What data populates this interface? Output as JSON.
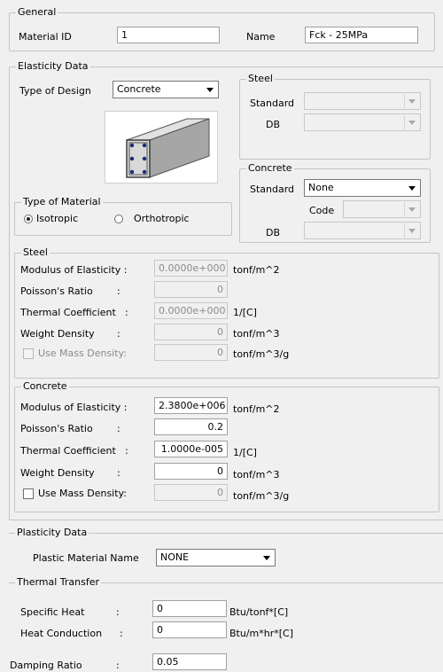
{
  "general": {
    "title": "General",
    "material_id_label": "Material ID",
    "material_id": "1",
    "name_label": "Name",
    "name": "Fck - 25MPa"
  },
  "elasticity": {
    "title": "Elasticity Data",
    "type_of_design_label": "Type of Design",
    "type_of_design": "Concrete",
    "type_of_material": {
      "title": "Type of Material",
      "isotropic": "Isotropic",
      "orthotropic": "Orthotropic",
      "selected": "Isotropic"
    },
    "steel_db": {
      "title": "Steel",
      "standard_label": "Standard",
      "standard": "",
      "db_label": "DB",
      "db": ""
    },
    "concrete_db": {
      "title": "Concrete",
      "standard_label": "Standard",
      "standard": "None",
      "code_label": "Code",
      "code": "",
      "db_label": "DB",
      "db": ""
    },
    "steel": {
      "title": "Steel",
      "modulus_label": "Modulus of Elasticity :",
      "modulus": "0.0000e+000",
      "modulus_unit": "tonf/m^2",
      "poisson_label": "Poisson's Ratio",
      "poisson": "0",
      "thermal_label": "Thermal Coefficient",
      "thermal": "0.0000e+000",
      "thermal_unit": "1/[C]",
      "weight_label": "Weight Density",
      "weight": "0",
      "weight_unit": "tonf/m^3",
      "mass_label": "Use Mass Density:",
      "mass": "0",
      "mass_unit": "tonf/m^3/g"
    },
    "concrete": {
      "title": "Concrete",
      "modulus_label": "Modulus of Elasticity :",
      "modulus": "2.3800e+006",
      "modulus_unit": "tonf/m^2",
      "poisson_label": "Poisson's Ratio",
      "poisson": "0.2",
      "thermal_label": "Thermal Coefficient",
      "thermal": "1.0000e-005",
      "thermal_unit": "1/[C]",
      "weight_label": "Weight Density",
      "weight": "0",
      "weight_unit": "tonf/m^3",
      "mass_label": "Use Mass Density:",
      "mass": "0",
      "mass_unit": "tonf/m^3/g"
    }
  },
  "plasticity": {
    "title": "Plasticity Data",
    "plastic_label": "Plastic Material Name",
    "plastic": "NONE"
  },
  "thermal_transfer": {
    "title": "Thermal Transfer",
    "specific_heat_label": "Specific Heat",
    "specific_heat": "0",
    "specific_heat_unit": "Btu/tonf*[C]",
    "conduction_label": "Heat Conduction",
    "conduction": "0",
    "conduction_unit": "Btu/m*hr*[C]"
  },
  "damping": {
    "label": "Damping Ratio",
    "value": "0.05"
  },
  "colon": ":"
}
